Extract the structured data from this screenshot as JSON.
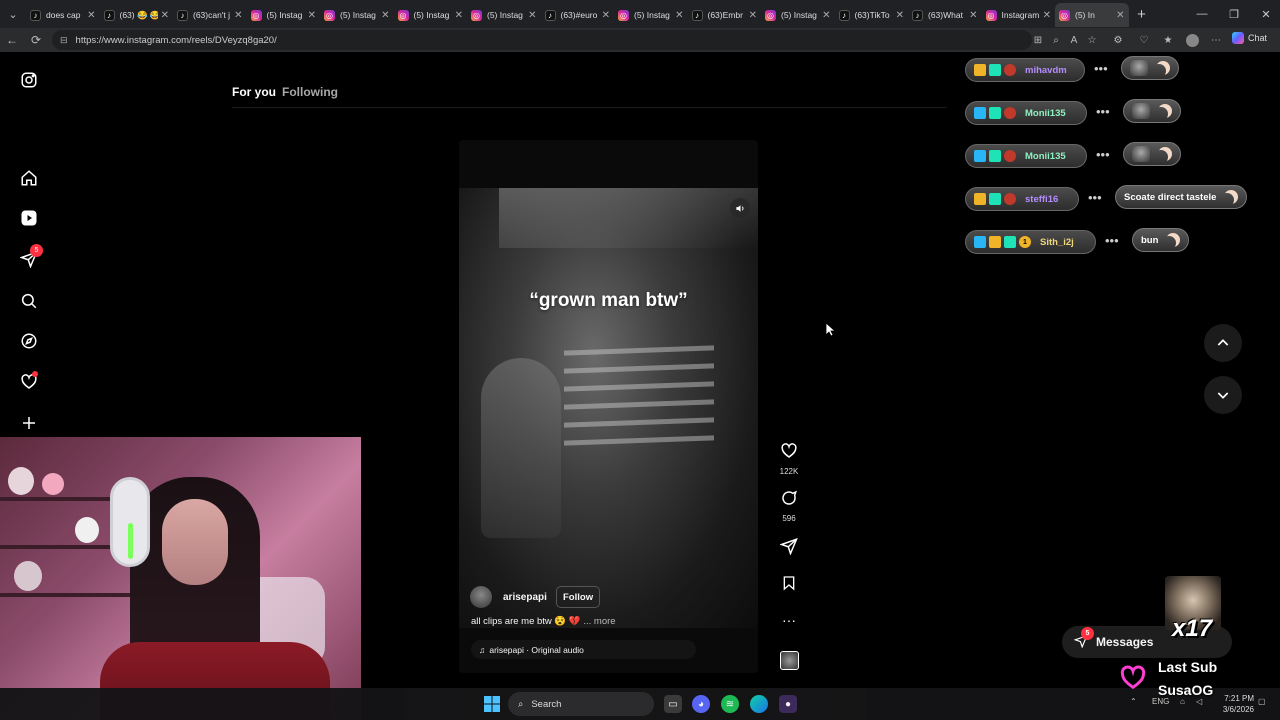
{
  "browser": {
    "tabs": [
      {
        "icon": "tiktok",
        "title": "does cap"
      },
      {
        "icon": "tiktok",
        "title": "(63) 😂 😂"
      },
      {
        "icon": "tiktok",
        "title": "(63)can't j"
      },
      {
        "icon": "instagram",
        "title": "(5) Instag"
      },
      {
        "icon": "instagram",
        "title": "(5) Instag"
      },
      {
        "icon": "instagram",
        "title": "(5) Instag"
      },
      {
        "icon": "instagram",
        "title": "(5) Instag"
      },
      {
        "icon": "tiktok",
        "title": "(63)#euro"
      },
      {
        "icon": "instagram",
        "title": "(5) Instag"
      },
      {
        "icon": "tiktok",
        "title": "(63)Embr"
      },
      {
        "icon": "instagram",
        "title": "(5) Instag"
      },
      {
        "icon": "tiktok",
        "title": "(63)TikTo"
      },
      {
        "icon": "tiktok",
        "title": "(63)What"
      },
      {
        "icon": "instagram",
        "title": "Instagram"
      },
      {
        "icon": "instagram",
        "title": "(5) In"
      }
    ],
    "url": "https://www.instagram.com/reels/DVeyzq8ga20/",
    "chat_label": "Chat"
  },
  "instagram": {
    "notification_count": "5",
    "feed_tabs": {
      "for_you": "For you",
      "following": "Following"
    },
    "reel": {
      "overlay_text": "“grown man btw”",
      "username": "arisepapi",
      "follow_label": "Follow",
      "caption": "all clips are me btw 😵 💔",
      "more_label": "... more",
      "audio": "arisepapi · Original audio",
      "likes": "122K",
      "comments": "596"
    }
  },
  "stream_chat": {
    "users": [
      {
        "name": "mihavdm",
        "color": "#b68cff"
      },
      {
        "name": "Monii135",
        "color": "#8ff0c0"
      },
      {
        "name": "Monii135",
        "color": "#8ff0c0"
      },
      {
        "name": "steffi16",
        "color": "#b68cff"
      },
      {
        "name": "Sith_i2j",
        "color": "#f0d67a"
      }
    ],
    "messages": [
      "",
      "",
      "",
      "Scoate direct tastele",
      "bun"
    ],
    "badge_number": "1"
  },
  "overlay": {
    "messages_label": "Messages",
    "messages_count": "5",
    "gift_multiplier": "x17",
    "last_sub_label": "Last Sub",
    "last_sub_name": "SusaOG"
  },
  "taskbar": {
    "search_placeholder": "Search",
    "language": "ENG",
    "time": "7:21 PM",
    "date": "3/6/2026"
  }
}
